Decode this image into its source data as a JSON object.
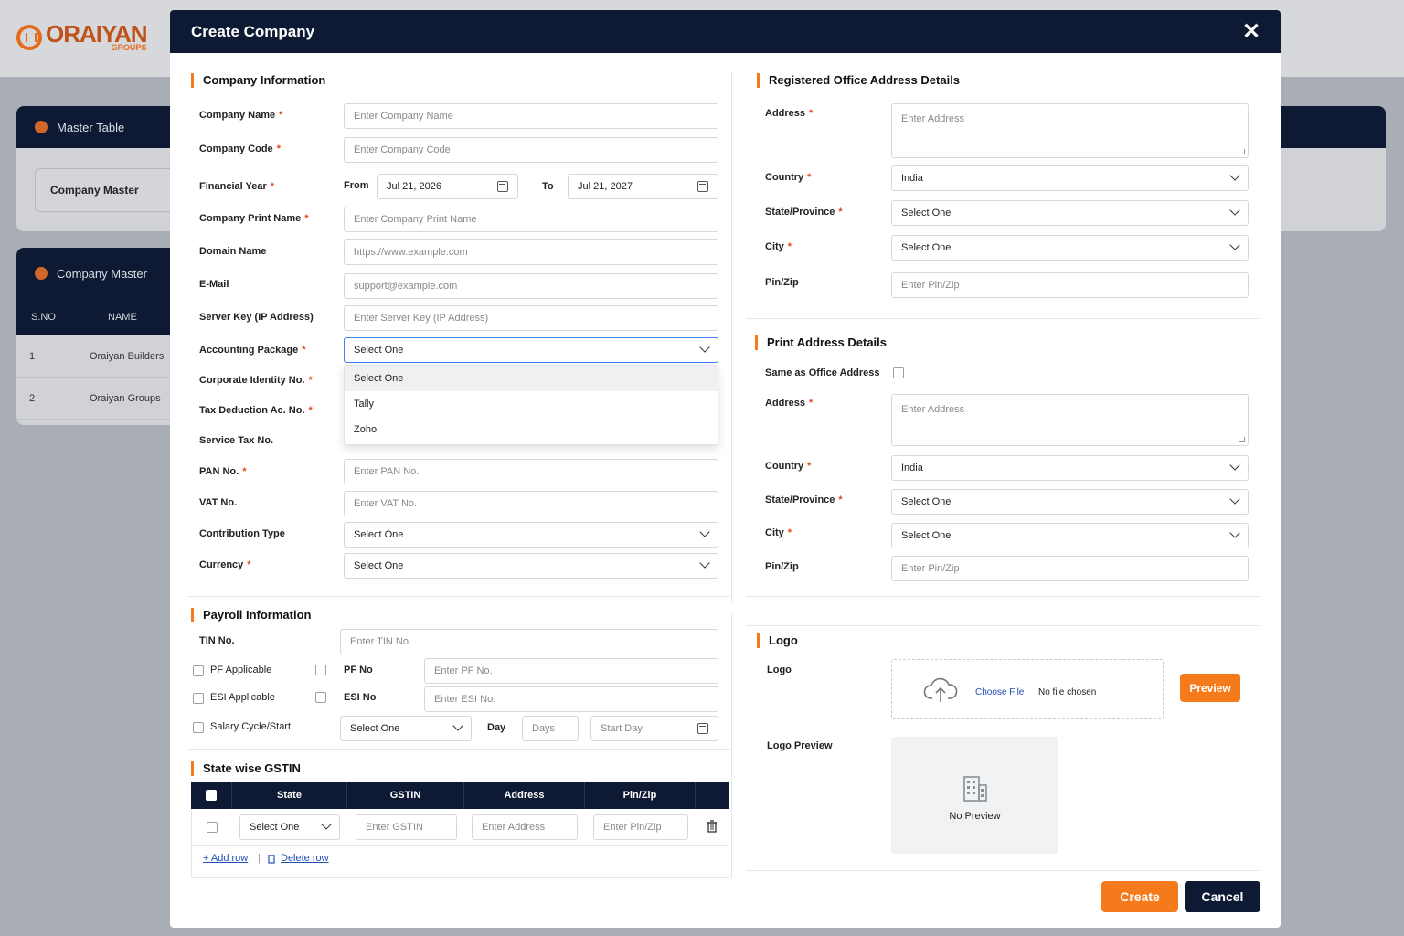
{
  "brand": {
    "name": "ORAIYAN",
    "sub": "GROUPS"
  },
  "background": {
    "master_table_title": "Master Table",
    "company_master_card": "Company Master",
    "company_master_title": "Company Master",
    "table_headers": [
      "S.NO",
      "NAME"
    ],
    "rows": [
      {
        "sno": "1",
        "name": "Oraiyan Builders"
      },
      {
        "sno": "2",
        "name": "Oraiyan Groups"
      }
    ]
  },
  "modal": {
    "title": "Create Company",
    "close": "✕"
  },
  "company_info": {
    "title": "Company Information",
    "company_name": {
      "label": "Company Name",
      "placeholder": "Enter Company Name"
    },
    "company_code": {
      "label": "Company Code",
      "placeholder": "Enter Company Code"
    },
    "financial_year": {
      "label": "Financial Year",
      "from_label": "From",
      "from_value": "Jul 21, 2026",
      "to_label": "To",
      "to_value": "Jul 21, 2027"
    },
    "print_name": {
      "label": "Company Print Name",
      "placeholder": "Enter Company Print Name"
    },
    "domain": {
      "label": "Domain Name",
      "placeholder": "https://www.example.com"
    },
    "email": {
      "label": "E-Mail",
      "placeholder": "support@example.com"
    },
    "server_key": {
      "label": "Server Key (IP Address)",
      "placeholder": "Enter Server Key (IP Address)"
    },
    "accounting_package": {
      "label": "Accounting Package",
      "value": "Select One",
      "options": [
        "Select One",
        "Tally",
        "Zoho"
      ]
    },
    "corporate_id": {
      "label": "Corporate Identity No."
    },
    "tax_deduction": {
      "label": "Tax Deduction Ac. No."
    },
    "service_tax": {
      "label": "Service Tax No."
    },
    "pan": {
      "label": "PAN No.",
      "placeholder": "Enter PAN No."
    },
    "vat": {
      "label": "VAT No.",
      "placeholder": "Enter VAT No."
    },
    "contribution_type": {
      "label": "Contribution Type",
      "value": "Select One"
    },
    "currency": {
      "label": "Currency",
      "value": "Select One"
    }
  },
  "payroll": {
    "title": "Payroll Information",
    "tin": {
      "label": "TIN No.",
      "placeholder": "Enter TIN No."
    },
    "pf_applicable": "PF Applicable",
    "pf_no": {
      "label": "PF No",
      "placeholder": "Enter PF No."
    },
    "esi_applicable": "ESI Applicable",
    "esi_no": {
      "label": "ESI No",
      "placeholder": "Enter ESI No."
    },
    "salary_cycle": {
      "label": "Salary Cycle/Start",
      "value": "Select One",
      "day_label": "Day",
      "days_placeholder": "Days",
      "start_day_placeholder": "Start Day"
    }
  },
  "gstin": {
    "title": "State wise GSTIN",
    "headers": [
      "State",
      "GSTIN",
      "Address",
      "Pin/Zip"
    ],
    "row": {
      "state": "Select One",
      "gstin_placeholder": "Enter GSTIN",
      "address_placeholder": "Enter Address",
      "pin_placeholder": "Enter Pin/Zip"
    },
    "add_row": "+ Add row",
    "separator": "|",
    "delete_row": "Delete row"
  },
  "registered_office": {
    "title": "Registered Office Address Details",
    "address": {
      "label": "Address",
      "placeholder": "Enter Address"
    },
    "country": {
      "label": "Country",
      "value": "India"
    },
    "state": {
      "label": "State/Province",
      "value": "Select One"
    },
    "city": {
      "label": "City",
      "value": "Select One"
    },
    "pin": {
      "label": "Pin/Zip",
      "placeholder": "Enter Pin/Zip"
    }
  },
  "print_address": {
    "title": "Print Address Details",
    "same_as_office": "Same as Office Address",
    "address": {
      "label": "Address",
      "placeholder": "Enter Address"
    },
    "country": {
      "label": "Country",
      "value": "India"
    },
    "state": {
      "label": "State/Province",
      "value": "Select One"
    },
    "city": {
      "label": "City",
      "value": "Select One"
    },
    "pin": {
      "label": "Pin/Zip",
      "placeholder": "Enter Pin/Zip"
    }
  },
  "logo": {
    "title": "Logo",
    "label": "Logo",
    "choose_file": "Choose File",
    "no_file": "No file chosen",
    "preview_button": "Preview",
    "preview_label": "Logo Preview",
    "no_preview": "No Preview"
  },
  "actions": {
    "create": "Create",
    "cancel": "Cancel"
  },
  "colors": {
    "accent": "#f57a1c",
    "navy": "#0e1a33",
    "required": "#e8491d",
    "link": "#1f4fb8"
  }
}
